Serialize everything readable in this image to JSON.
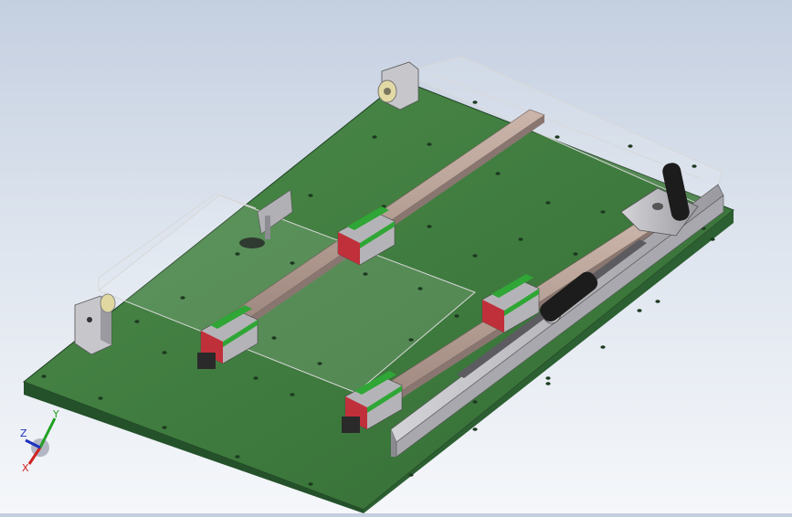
{
  "viewport": {
    "background_top": "#c4cfe0",
    "background_bottom": "#f5f7fa"
  },
  "model": {
    "colors": {
      "board_top": "#3f7d3f",
      "board_edge": "#24512a",
      "rail": "#b69e94",
      "block_red": "#c0303a",
      "block_green": "#2fa635",
      "metal": "#b4b4b8",
      "handle": "#1a1a1a"
    },
    "parts": [
      "base-plate",
      "linear-rail",
      "carriage-block",
      "end-support",
      "crank-handle",
      "adjust-screw",
      "transparent-cover"
    ]
  },
  "triad": {
    "x_label": "X",
    "y_label": "Y",
    "z_label": "Z",
    "x_color": "#d02020",
    "y_color": "#20a020",
    "z_color": "#2030c0"
  }
}
